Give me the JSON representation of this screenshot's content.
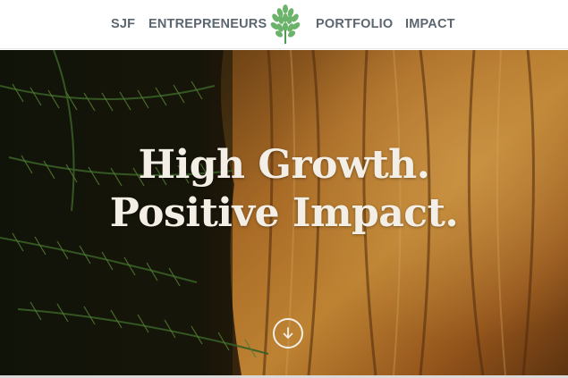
{
  "nav": {
    "items": [
      {
        "label": "SJF"
      },
      {
        "label": "ENTREPRENEURS"
      },
      {
        "label": "PORTFOLIO"
      },
      {
        "label": "IMPACT"
      }
    ],
    "logo_icon": "leaf-tree-logo-icon",
    "text_color": "#5b6670",
    "logo_color": "#6bb36b"
  },
  "hero": {
    "headline_line1": "High Growth.",
    "headline_line2": "Positive Impact.",
    "scroll_icon": "arrow-down-circle-icon",
    "text_color": "#f4efe6"
  }
}
